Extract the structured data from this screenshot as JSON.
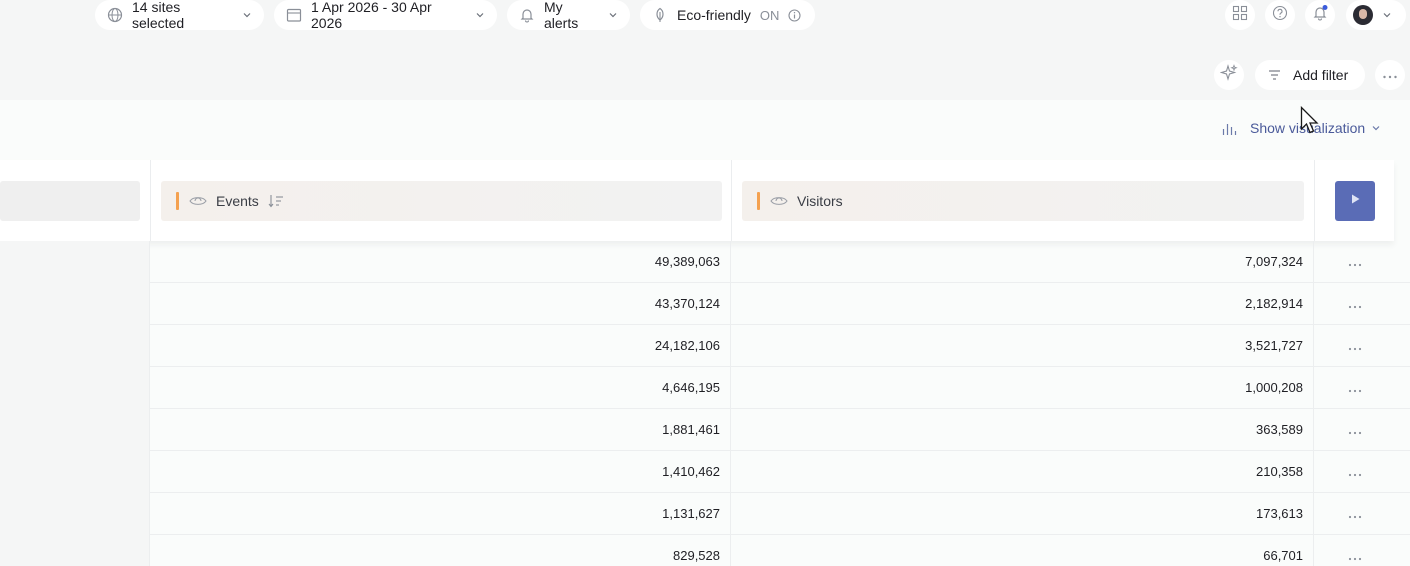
{
  "topbar": {
    "sites_label": "14 sites selected",
    "date_label": "1 Apr 2026 - 30 Apr 2026",
    "alerts_label": "My alerts",
    "eco_label": "Eco-friendly",
    "eco_state": "ON"
  },
  "filterbar": {
    "add_filter_label": "Add filter"
  },
  "content": {
    "show_viz_label": "Show visualization"
  },
  "table": {
    "columns": [
      {
        "label": "Events"
      },
      {
        "label": "Visitors"
      }
    ],
    "rows": [
      {
        "events": "49,389,063",
        "visitors": "7,097,324"
      },
      {
        "events": "43,370,124",
        "visitors": "2,182,914"
      },
      {
        "events": "24,182,106",
        "visitors": "3,521,727"
      },
      {
        "events": "4,646,195",
        "visitors": "1,000,208"
      },
      {
        "events": "1,881,461",
        "visitors": "363,589"
      },
      {
        "events": "1,410,462",
        "visitors": "210,358"
      },
      {
        "events": "1,131,627",
        "visitors": "173,613"
      },
      {
        "events": "829,528",
        "visitors": "66,701"
      }
    ]
  },
  "colors": {
    "accent": "#5a6cb6",
    "metric_bar": "#f4a150",
    "link": "#4a5a9a",
    "notification_dot": "#3b5bdb"
  },
  "icons": [
    "globe-icon",
    "calendar-icon",
    "bell-icon",
    "leaf-icon",
    "info-icon",
    "grid-icon",
    "help-icon",
    "notification-bell-icon",
    "sparkle-icon",
    "filter-icon",
    "more-icon",
    "bar-chart-icon",
    "eye-icon",
    "sort-icon",
    "play-icon",
    "row-more-icon"
  ]
}
